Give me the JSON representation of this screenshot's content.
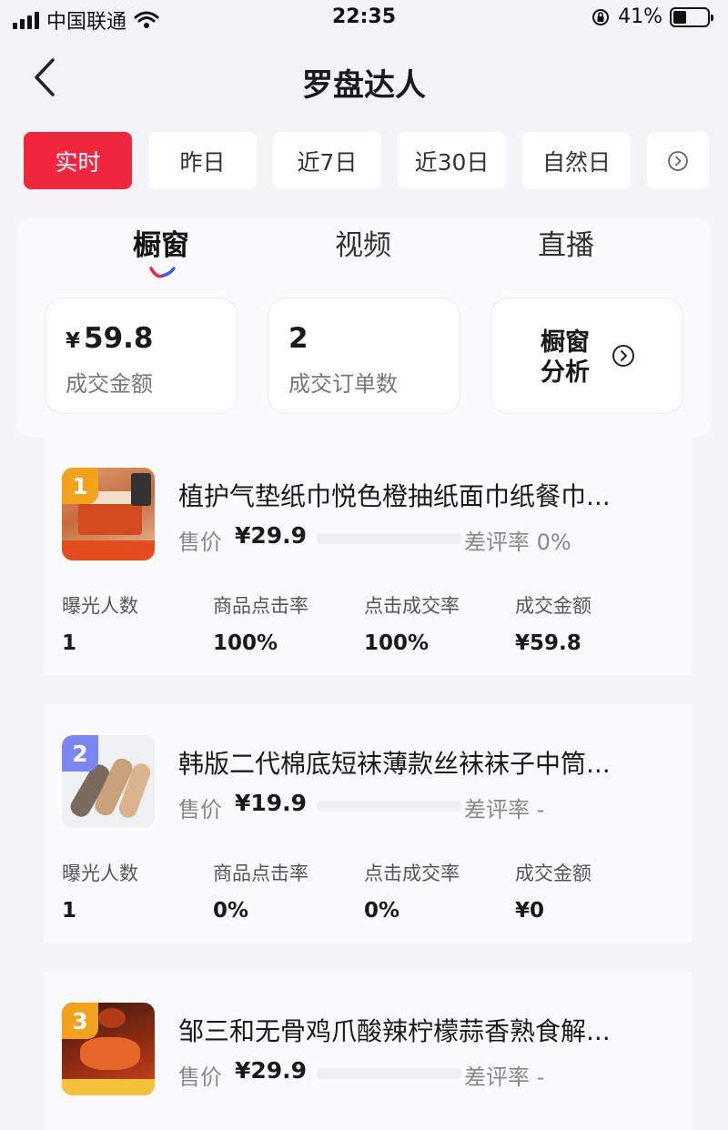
{
  "status_bar": {
    "carrier": "中国联通",
    "time": "22:35",
    "battery": "41%"
  },
  "header": {
    "title": "罗盘达人"
  },
  "periods": [
    {
      "label": "实时",
      "active": true
    },
    {
      "label": "昨日",
      "active": false
    },
    {
      "label": "近7日",
      "active": false
    },
    {
      "label": "近30日",
      "active": false
    },
    {
      "label": "自然日",
      "active": false
    }
  ],
  "tabs": [
    {
      "label": "橱窗",
      "active": true
    },
    {
      "label": "视频",
      "active": false
    },
    {
      "label": "直播",
      "active": false
    }
  ],
  "stats": {
    "gmv": {
      "currency": "¥",
      "value": "59.8",
      "label": "成交金额"
    },
    "orders": {
      "value": "2",
      "label": "成交订单数"
    },
    "analysis": {
      "label": "橱窗分析"
    }
  },
  "accent_color": "#f0263f",
  "products": [
    {
      "rank": "1",
      "title": "植护气垫纸巾悦色橙抽纸面巾纸餐巾...",
      "price_label": "售价",
      "price": "¥29.9",
      "neg_rate": "差评率 0%",
      "metrics": [
        {
          "label": "曝光人数",
          "value": "1"
        },
        {
          "label": "商品点击率",
          "value": "100%"
        },
        {
          "label": "点击成交率",
          "value": "100%"
        },
        {
          "label": "成交金额",
          "value": "¥59.8"
        }
      ]
    },
    {
      "rank": "2",
      "title": "韩版二代棉底短袜薄款丝袜袜子中筒...",
      "price_label": "售价",
      "price": "¥19.9",
      "neg_rate": "差评率 -",
      "metrics": [
        {
          "label": "曝光人数",
          "value": "1"
        },
        {
          "label": "商品点击率",
          "value": "0%"
        },
        {
          "label": "点击成交率",
          "value": "0%"
        },
        {
          "label": "成交金额",
          "value": "¥0"
        }
      ]
    },
    {
      "rank": "3",
      "title": "邹三和无骨鸡爪酸辣柠檬蒜香熟食解...",
      "price_label": "售价",
      "price": "¥29.9",
      "neg_rate": "差评率 -"
    }
  ]
}
